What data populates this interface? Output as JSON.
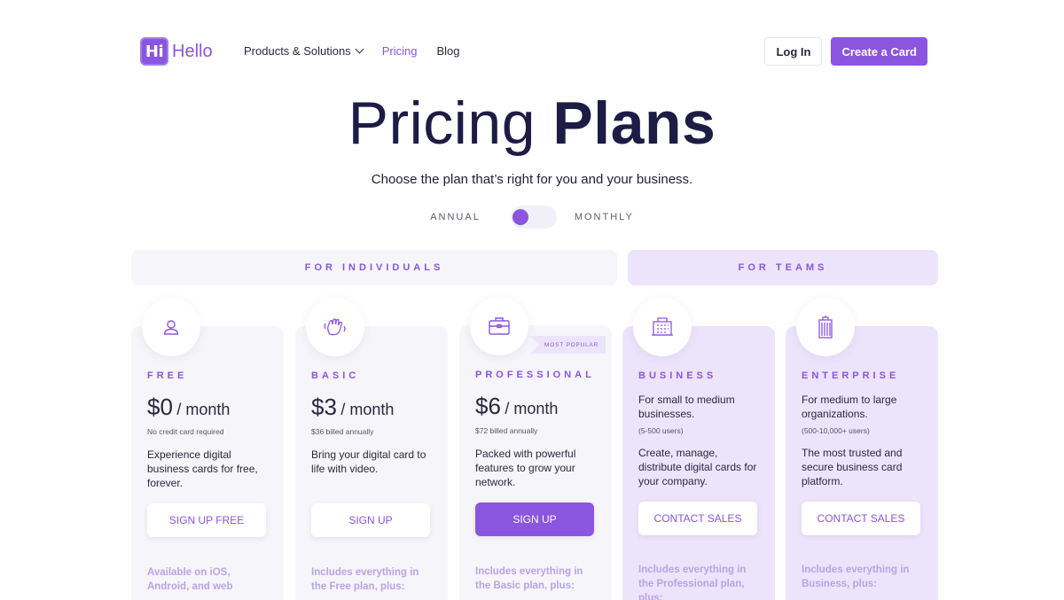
{
  "nav": {
    "logo_mark": "Hi",
    "logo_text": "Hello",
    "links": [
      "Products & Solutions",
      "Pricing",
      "Blog"
    ],
    "login_label": "Log In",
    "create_label": "Create a Card"
  },
  "hero": {
    "title_light": "Pricing",
    "title_bold": "Plans",
    "subtitle": "Choose the plan that’s right for you and your business."
  },
  "billing_toggle": {
    "left_label": "ANNUAL",
    "right_label": "MONTHLY",
    "selected": "ANNUAL"
  },
  "sections": {
    "individuals": "FOR INDIVIDUALS",
    "teams": "FOR TEAMS"
  },
  "plans": [
    {
      "name": "FREE",
      "amount": "$0",
      "period": "/ month",
      "note": "No credit card required",
      "desc": "Experience digital business cards for free, forever.",
      "cta": "SIGN UP FREE",
      "footnote": "Available on iOS, Android, and web"
    },
    {
      "name": "BASIC",
      "amount": "$3",
      "period": "/ month",
      "note": "$36 billed annually",
      "desc": "Bring your digital card to life with video.",
      "cta": "SIGN UP",
      "footnote": "Includes everything in the Free plan, plus:"
    },
    {
      "name": "PROFESSIONAL",
      "amount": "$6",
      "period": "/ month",
      "note": "$72 billed annually",
      "desc": "Packed with powerful features to grow your network.",
      "cta": "SIGN UP",
      "footnote": "Includes everything in the Basic plan, plus:",
      "badge": "MOST POPULAR"
    },
    {
      "name": "BUSINESS",
      "tagline": "For small to medium businesses.",
      "note": "(5-500 users)",
      "desc": "Create, manage, distribute digital cards for your company.",
      "cta": "CONTACT SALES",
      "footnote": "Includes everything in the Professional plan, plus:"
    },
    {
      "name": "ENTERPRISE",
      "tagline": "For medium to large organizations.",
      "note": "(500-10,000+ users)",
      "desc": "The most trusted and secure business card platform.",
      "cta": "CONTACT SALES",
      "footnote": "Includes everything in Business, plus:"
    }
  ],
  "colors": {
    "accent": "#8a55df",
    "team_bg": "#ece4fa",
    "individual_bg": "#f6f5f9",
    "title": "#1e1b45"
  }
}
